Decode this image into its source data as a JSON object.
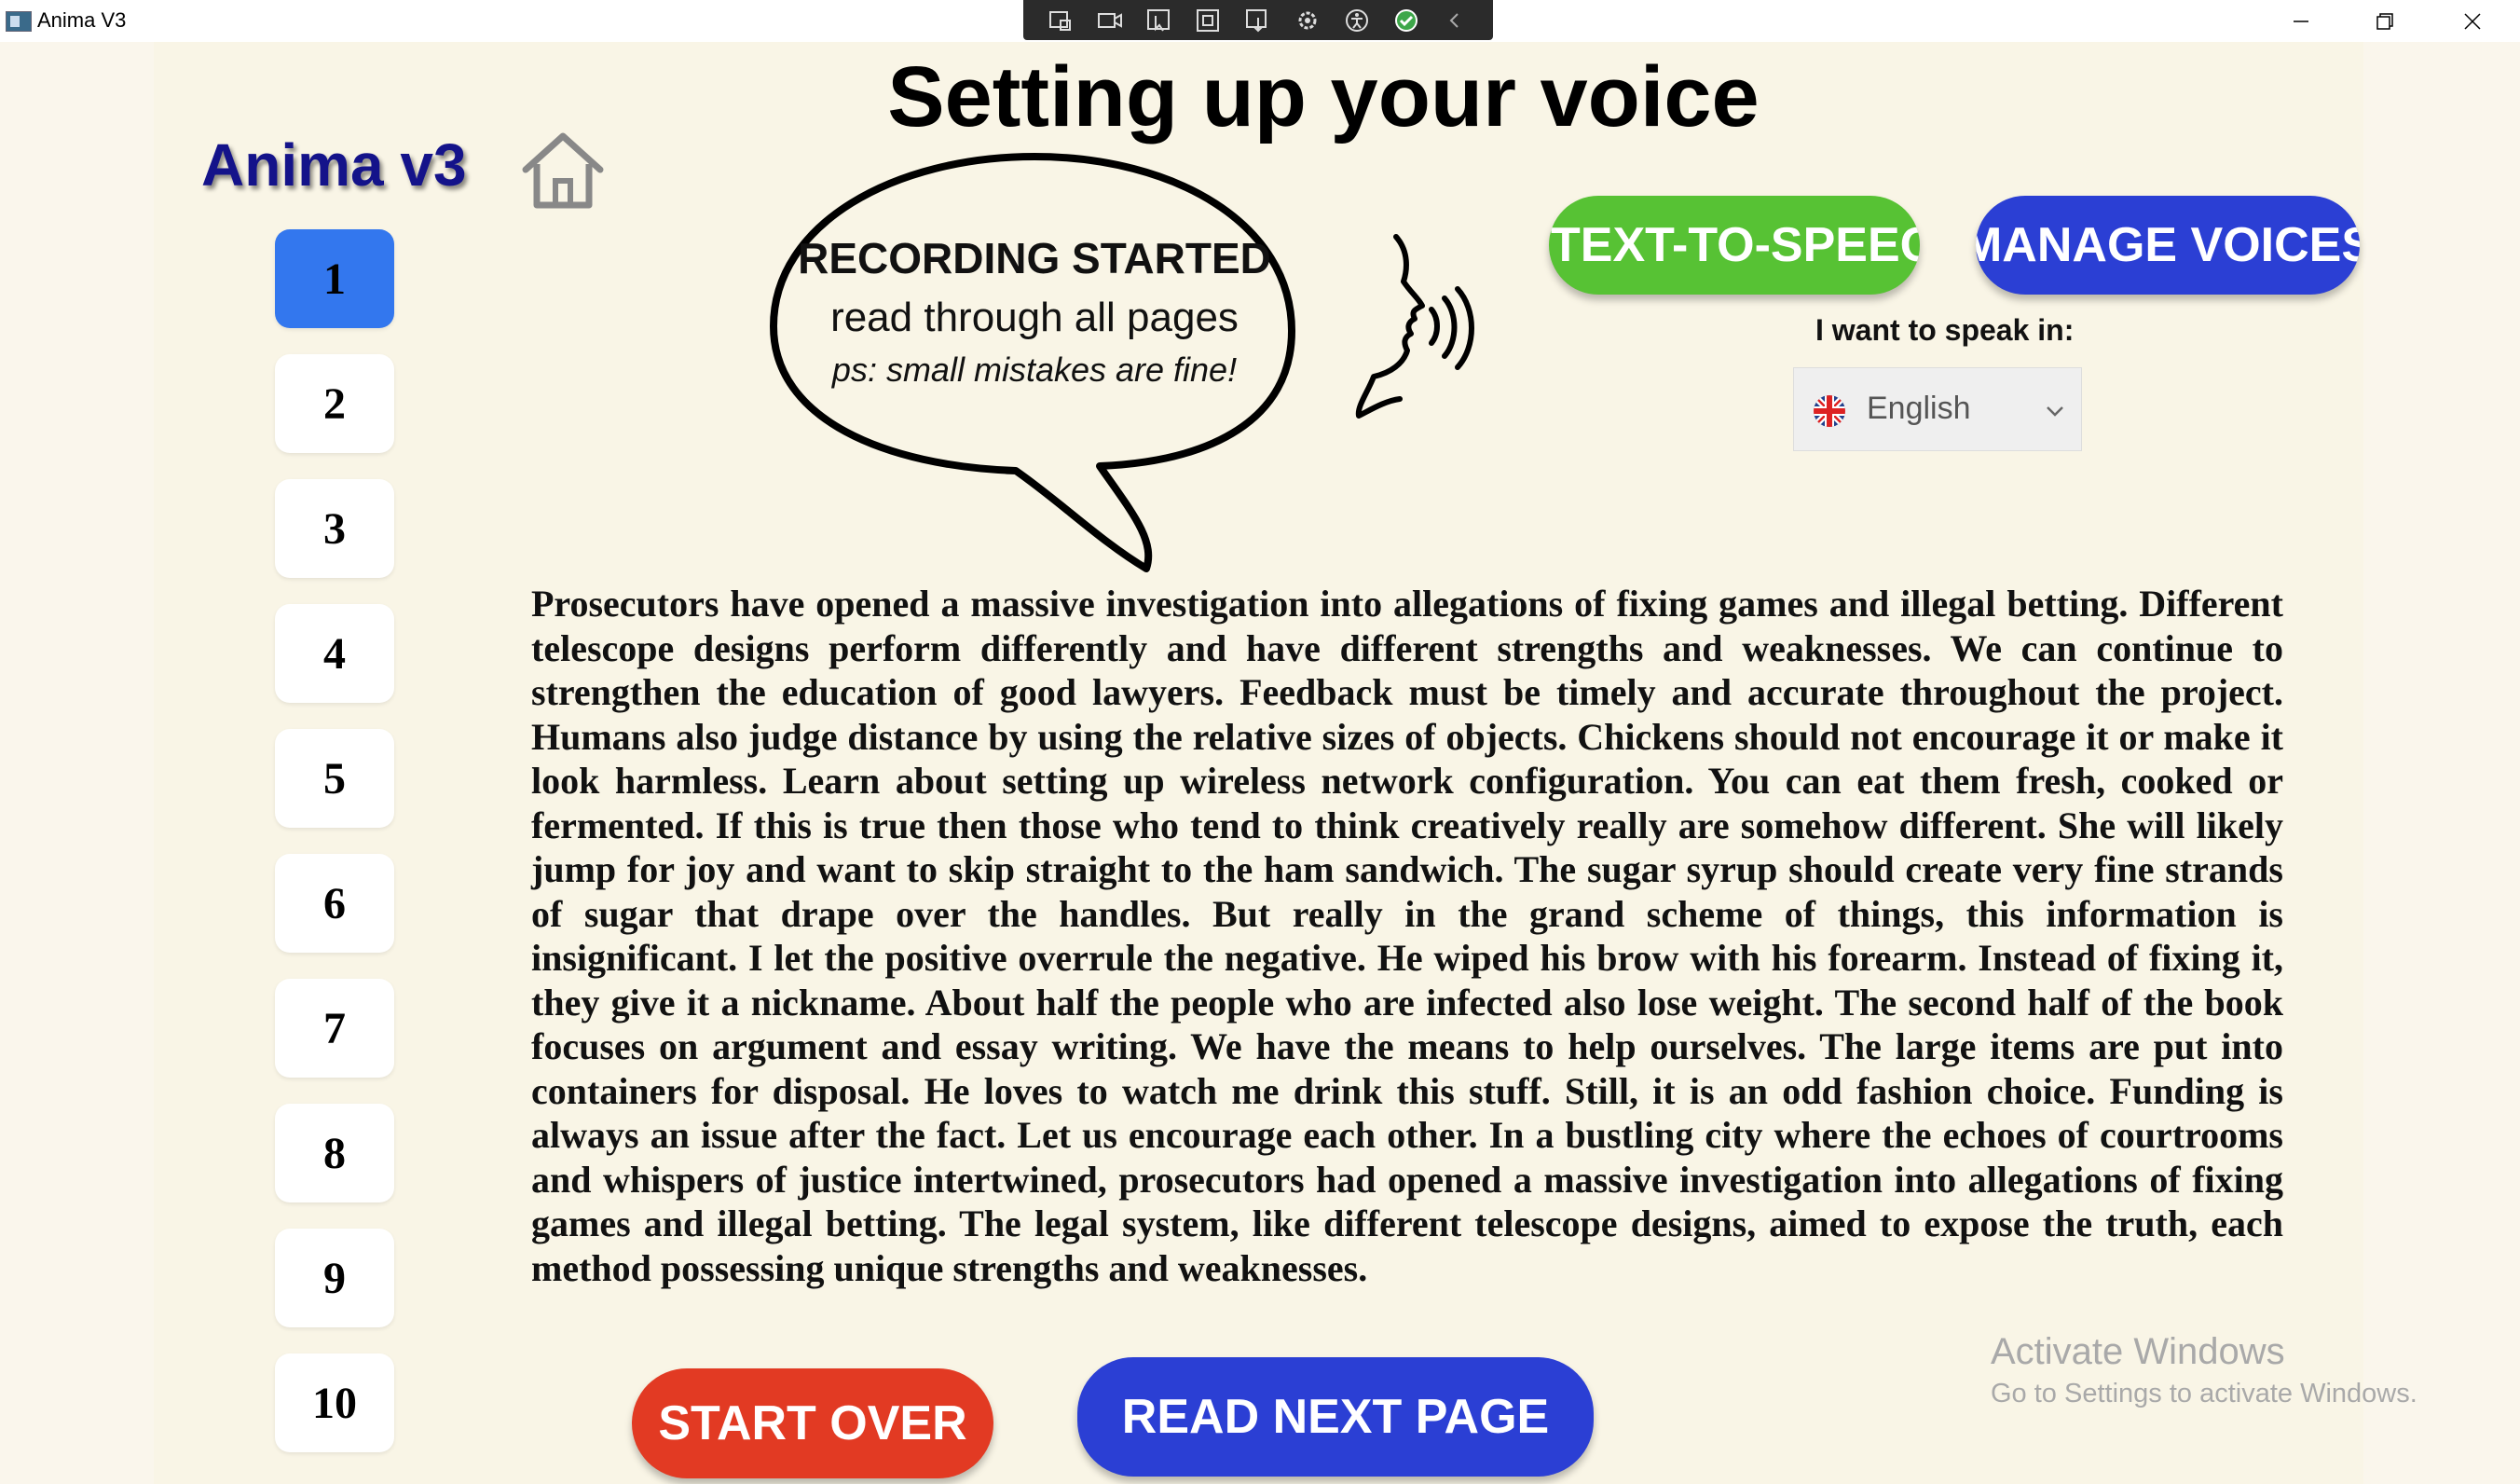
{
  "window": {
    "title": "Anima V3"
  },
  "app": {
    "brand": "Anima v3",
    "page_title": "Setting up your voice"
  },
  "pages": [
    "1",
    "2",
    "3",
    "4",
    "5",
    "6",
    "7",
    "8",
    "9",
    "10"
  ],
  "active_page": "1",
  "bubble": {
    "heading": "RECORDING STARTED",
    "subheading": "read through all pages",
    "note": "ps: small mistakes are fine!"
  },
  "buttons": {
    "tts": "TEXT-TO-SPEECH",
    "manage_voices": "MANAGE VOICES",
    "start_over": "START OVER",
    "read_next": "READ NEXT PAGE"
  },
  "language": {
    "label": "I want to speak in:",
    "selected": "English",
    "flag_icon": "uk-flag-icon"
  },
  "passage": "Prosecutors have opened a massive investigation into allegations of fixing games and illegal betting. Different telescope designs perform differently and have different strengths and weaknesses. We can continue to strengthen the education of good lawyers. Feedback must be timely and accurate throughout the project. Humans also judge distance by using the relative sizes of objects. Chickens should not encourage it or make it look harmless. Learn about setting up wireless network configuration. You can eat them fresh, cooked or fermented. If this is true then those who tend to think creatively really are somehow different. She will likely jump for joy and want to skip straight to the ham sandwich. The sugar syrup should create very fine strands of sugar that drape over the handles. But really in the grand scheme of things, this information is insignificant. I let the positive overrule the negative. He wiped his brow with his forearm. Instead of fixing it, they give it a nickname. About half the people who are infected also lose weight. The second half of the book focuses on argument and essay writing. We have the means to help ourselves. The large items are put into containers for disposal. He loves to watch me drink this stuff. Still, it is an odd fashion choice. Funding is always an issue after the fact. Let us encourage each other. In a bustling city where the echoes of courtrooms and whispers of justice intertwined, prosecutors had opened a massive investigation into allegations of fixing games and illegal betting. The legal system, like different telescope designs, aimed to expose the truth, each method possessing unique strengths and weaknesses.",
  "watermark": {
    "title": "Activate Windows",
    "subtitle": "Go to Settings to activate Windows."
  },
  "colors": {
    "background": "#f9f5e6",
    "brand": "#14138a",
    "active_page": "#3377ee",
    "tts_button": "#57c234",
    "blue_button": "#2b3fd4",
    "start_over_button": "#e23a23"
  }
}
